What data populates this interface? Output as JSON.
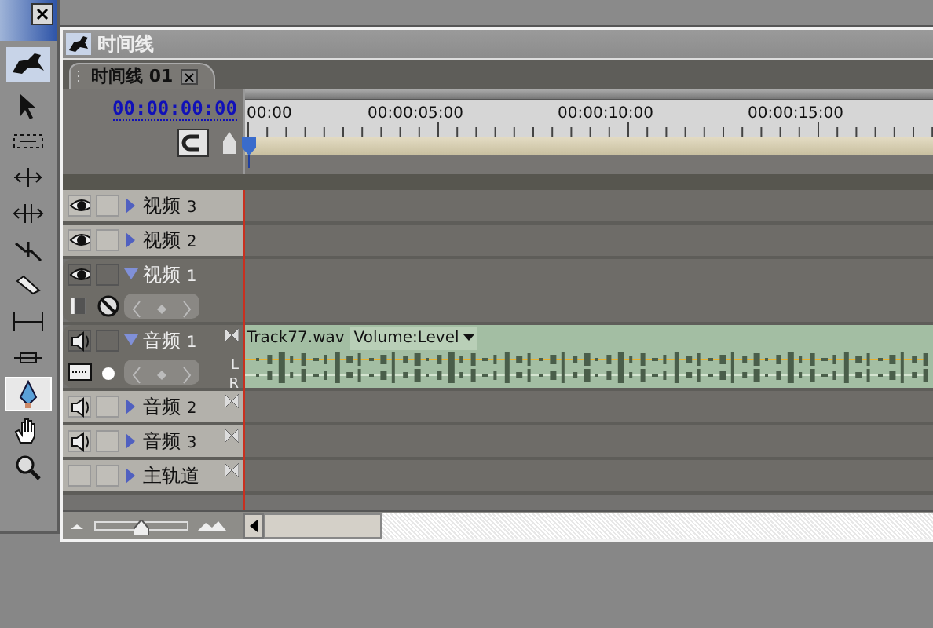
{
  "tools_panel": {
    "tools": [
      {
        "kind": "select",
        "selected": false
      },
      {
        "kind": "range",
        "selected": false
      },
      {
        "kind": "ripple",
        "selected": false
      },
      {
        "kind": "roll",
        "selected": false
      },
      {
        "kind": "stretch",
        "selected": false
      },
      {
        "kind": "razor",
        "selected": false
      },
      {
        "kind": "slip",
        "selected": false
      },
      {
        "kind": "slide",
        "selected": false
      },
      {
        "kind": "pen",
        "selected": true
      },
      {
        "kind": "hand",
        "selected": false
      },
      {
        "kind": "zoom",
        "selected": false
      }
    ]
  },
  "window": {
    "title": "时间线"
  },
  "tabs": [
    {
      "label": "时间线 01",
      "selected": true
    }
  ],
  "timecode": "00:00:00:00",
  "ruler": {
    "labels": [
      "00:00",
      "00:00:05:00",
      "00:00:10:00",
      "00:00:15:00"
    ]
  },
  "tracks": [
    {
      "kind": "video",
      "name": "视频",
      "number": "3",
      "expanded": false
    },
    {
      "kind": "video",
      "name": "视频",
      "number": "2",
      "expanded": false
    },
    {
      "kind": "video",
      "name": "视频",
      "number": "1",
      "expanded": true
    },
    {
      "kind": "audio",
      "name": "音频",
      "number": "1",
      "expanded": true,
      "clip": {
        "name": "Track77.wav",
        "effect": "Volume:Level",
        "channels": [
          "L",
          "R"
        ]
      }
    },
    {
      "kind": "audio",
      "name": "音频",
      "number": "2",
      "expanded": false
    },
    {
      "kind": "audio",
      "name": "音频",
      "number": "3",
      "expanded": false
    },
    {
      "kind": "master",
      "name": "主轨道",
      "expanded": false
    }
  ],
  "zoom_slider": {
    "level": 0.5
  }
}
